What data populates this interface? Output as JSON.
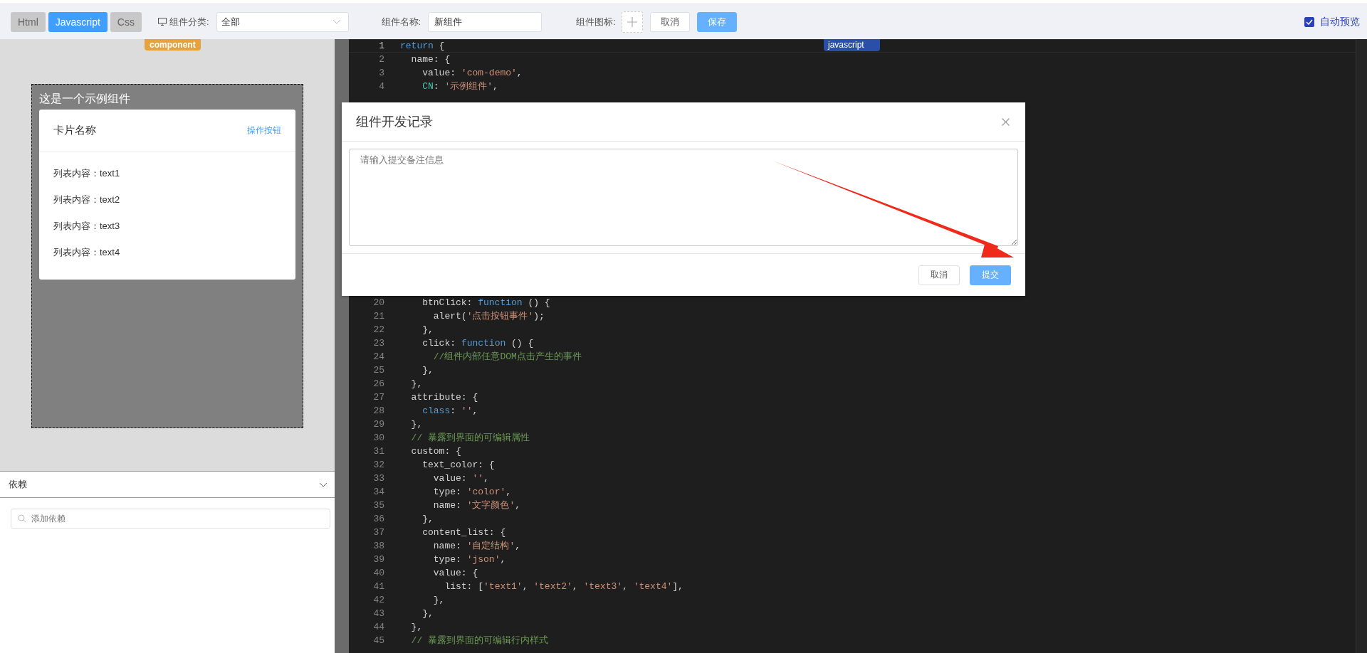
{
  "toolbar": {
    "tabs": [
      {
        "label": "Html",
        "selected": false
      },
      {
        "label": "Javascript",
        "selected": true
      },
      {
        "label": "Css",
        "selected": false
      }
    ],
    "category": {
      "label": "组件分类:",
      "value": "全部"
    },
    "name": {
      "label": "组件名称:",
      "value": "新组件"
    },
    "icon": {
      "label": "组件图标:"
    },
    "buttons": [
      {
        "label": "取消",
        "kind": "default"
      },
      {
        "label": "保存",
        "kind": "primary"
      }
    ],
    "auto_preview": {
      "label": "自动预览",
      "checked": true
    }
  },
  "preview": {
    "tag": "component",
    "title": "这是一个示例组件",
    "card": {
      "title": "卡片名称",
      "action": "操作按钮",
      "items": [
        "列表内容：text1",
        "列表内容：text2",
        "列表内容：text3",
        "列表内容：text4"
      ]
    }
  },
  "dependencies": {
    "title": "依赖",
    "search": {
      "placeholder": "添加依赖"
    }
  },
  "editor": {
    "language": "javascript",
    "lines": [
      {
        "n": "1",
        "tokens": [
          {
            "kind": "kw",
            "text": "return"
          },
          {
            "kind": "text",
            "text": " {"
          }
        ]
      },
      {
        "n": "2",
        "tokens": [
          {
            "kind": "text",
            "text": "  name: {"
          }
        ]
      },
      {
        "n": "3",
        "tokens": [
          {
            "kind": "text",
            "text": "    value: "
          },
          {
            "kind": "str",
            "text": "'com-demo'"
          },
          {
            "kind": "text",
            "text": ","
          }
        ]
      },
      {
        "n": "4",
        "tokens": [
          {
            "kind": "key",
            "text": "    CN"
          },
          {
            "kind": "text",
            "text": ": "
          },
          {
            "kind": "str",
            "text": "'示例组件'"
          },
          {
            "kind": "text",
            "text": ","
          }
        ]
      },
      {
        "n": "20",
        "tokens": [
          {
            "kind": "text",
            "text": "    btnClick: "
          },
          {
            "kind": "kw",
            "text": "function"
          },
          {
            "kind": "text",
            "text": " () {"
          }
        ]
      },
      {
        "n": "21",
        "tokens": [
          {
            "kind": "text",
            "text": "      alert("
          },
          {
            "kind": "str",
            "text": "'点击按钮事件'"
          },
          {
            "kind": "text",
            "text": ");"
          }
        ]
      },
      {
        "n": "22",
        "tokens": [
          {
            "kind": "text",
            "text": "    },"
          }
        ]
      },
      {
        "n": "23",
        "tokens": [
          {
            "kind": "text",
            "text": "    click: "
          },
          {
            "kind": "kw",
            "text": "function"
          },
          {
            "kind": "text",
            "text": " () {"
          }
        ]
      },
      {
        "n": "24",
        "tokens": [
          {
            "kind": "com",
            "text": "      //组件内部任意DOM点击产生的事件"
          }
        ]
      },
      {
        "n": "25",
        "tokens": [
          {
            "kind": "text",
            "text": "    },"
          }
        ]
      },
      {
        "n": "26",
        "tokens": [
          {
            "kind": "text",
            "text": "  },"
          }
        ]
      },
      {
        "n": "27",
        "tokens": [
          {
            "kind": "text",
            "text": "  attribute: {"
          }
        ]
      },
      {
        "n": "28",
        "tokens": [
          {
            "kind": "kw",
            "text": "    class"
          },
          {
            "kind": "text",
            "text": ": "
          },
          {
            "kind": "str",
            "text": "''"
          },
          {
            "kind": "text",
            "text": ","
          }
        ]
      },
      {
        "n": "29",
        "tokens": [
          {
            "kind": "text",
            "text": "  },"
          }
        ]
      },
      {
        "n": "30",
        "tokens": [
          {
            "kind": "com",
            "text": "  // 暴露到界面的可编辑属性"
          }
        ]
      },
      {
        "n": "31",
        "tokens": [
          {
            "kind": "text",
            "text": "  custom: {"
          }
        ]
      },
      {
        "n": "32",
        "tokens": [
          {
            "kind": "text",
            "text": "    text_color: {"
          }
        ]
      },
      {
        "n": "33",
        "tokens": [
          {
            "kind": "text",
            "text": "      value: "
          },
          {
            "kind": "str",
            "text": "''"
          },
          {
            "kind": "text",
            "text": ","
          }
        ]
      },
      {
        "n": "34",
        "tokens": [
          {
            "kind": "text",
            "text": "      type: "
          },
          {
            "kind": "str",
            "text": "'color'"
          },
          {
            "kind": "text",
            "text": ","
          }
        ]
      },
      {
        "n": "35",
        "tokens": [
          {
            "kind": "text",
            "text": "      name: "
          },
          {
            "kind": "str",
            "text": "'文字颜色'"
          },
          {
            "kind": "text",
            "text": ","
          }
        ]
      },
      {
        "n": "36",
        "tokens": [
          {
            "kind": "text",
            "text": "    },"
          }
        ]
      },
      {
        "n": "37",
        "tokens": [
          {
            "kind": "text",
            "text": "    content_list: {"
          }
        ]
      },
      {
        "n": "38",
        "tokens": [
          {
            "kind": "text",
            "text": "      name: "
          },
          {
            "kind": "str",
            "text": "'自定结构'"
          },
          {
            "kind": "text",
            "text": ","
          }
        ]
      },
      {
        "n": "39",
        "tokens": [
          {
            "kind": "text",
            "text": "      type: "
          },
          {
            "kind": "str",
            "text": "'json'"
          },
          {
            "kind": "text",
            "text": ","
          }
        ]
      },
      {
        "n": "40",
        "tokens": [
          {
            "kind": "text",
            "text": "      value: {"
          }
        ]
      },
      {
        "n": "41",
        "tokens": [
          {
            "kind": "text",
            "text": "        list: ["
          },
          {
            "kind": "str",
            "text": "'text1'"
          },
          {
            "kind": "text",
            "text": ", "
          },
          {
            "kind": "str",
            "text": "'text2'"
          },
          {
            "kind": "text",
            "text": ", "
          },
          {
            "kind": "str",
            "text": "'text3'"
          },
          {
            "kind": "text",
            "text": ", "
          },
          {
            "kind": "str",
            "text": "'text4'"
          },
          {
            "kind": "text",
            "text": "],"
          }
        ]
      },
      {
        "n": "42",
        "tokens": [
          {
            "kind": "text",
            "text": "      },"
          }
        ]
      },
      {
        "n": "43",
        "tokens": [
          {
            "kind": "text",
            "text": "    },"
          }
        ]
      },
      {
        "n": "44",
        "tokens": [
          {
            "kind": "text",
            "text": "  },"
          }
        ]
      },
      {
        "n": "45",
        "tokens": [
          {
            "kind": "com",
            "text": "  // 暴露到界面的可编辑行内样式"
          }
        ]
      }
    ]
  },
  "dialog": {
    "title": "组件开发记录",
    "textarea": {
      "placeholder": "请输入提交备注信息"
    },
    "buttons": [
      {
        "label": "取消",
        "kind": "default"
      },
      {
        "label": "提交",
        "kind": "primary"
      }
    ]
  }
}
